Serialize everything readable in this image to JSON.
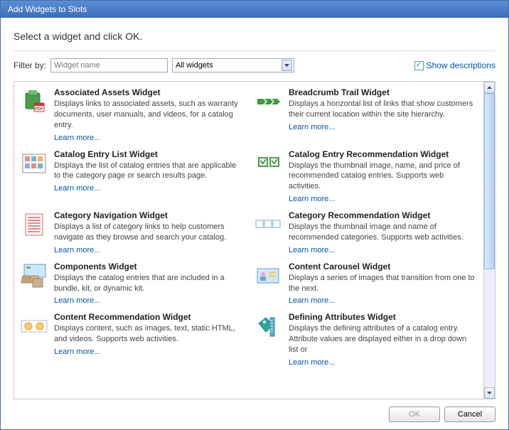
{
  "title": "Add Widgets to Slots",
  "instruction": "Select a widget and click OK.",
  "filter": {
    "label": "Filter by:",
    "placeholder": "Widget name",
    "value": "",
    "select_value": "All widgets"
  },
  "show_descriptions": {
    "label": "Show descriptions",
    "checked": true
  },
  "learn_more_label": "Learn more...",
  "widgets": [
    {
      "title": "Associated Assets Widget",
      "desc": "Displays links to associated assets, such as warranty documents, user manuals, and videos, for a catalog entry.",
      "icon": "bag-pdf"
    },
    {
      "title": "Breadcrumb Trail Widget",
      "desc": "Displays a horizontal list of links that show customers their current location within the site hierarchy.",
      "icon": "arrows"
    },
    {
      "title": "Catalog Entry List Widget",
      "desc": "Displays the list of catalog entries that are applicable to the category page or search results page.",
      "icon": "grid-boxes"
    },
    {
      "title": "Catalog Entry Recommendation Widget",
      "desc": "Displays the thumbnail image, name, and price of recommended catalog entries. Supports web activities.",
      "icon": "two-boxes"
    },
    {
      "title": "Category Navigation Widget",
      "desc": "Displays a list of category links to help customers navigate as they browse and search your catalog.",
      "icon": "list-lines"
    },
    {
      "title": "Category Recommendation Widget",
      "desc": "Displays the thumbnail image and name of recommended categories. Supports web activities.",
      "icon": "three-boxes-h"
    },
    {
      "title": "Components Widget",
      "desc": "Displays the catalog entries that are included in a bundle, kit, or dynamic kit.",
      "icon": "boxes-3d"
    },
    {
      "title": "Content Carousel Widget",
      "desc": "Displays a series of images that transition from one to the next.",
      "icon": "user-slides"
    },
    {
      "title": "Content Recommendation Widget",
      "desc": "Displays content, such as images, text, static HTML, and videos. Supports web activities.",
      "icon": "two-circles"
    },
    {
      "title": "Defining Attributes Widget",
      "desc": "Displays the defining attributes of a catalog entry. Attribute values are displayed either in a drop down list or",
      "icon": "tag-ruler"
    }
  ],
  "buttons": {
    "ok": "OK",
    "cancel": "Cancel"
  }
}
